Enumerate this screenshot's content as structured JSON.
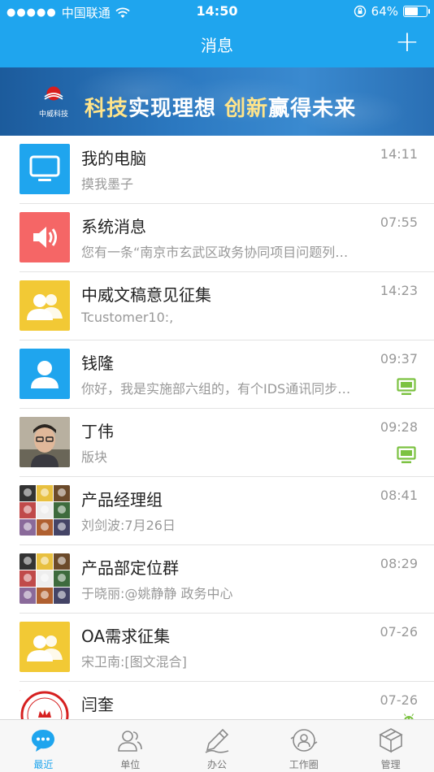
{
  "status_bar": {
    "signal": "●●●●●",
    "carrier": "中国联通",
    "time": "14:50",
    "battery": "64%",
    "battery_level": 0.64
  },
  "nav": {
    "title": "消息",
    "add_label": "+"
  },
  "banner": {
    "logo_text": "中威科技",
    "slogan_hl1": "科技",
    "slogan_1": "实现理想 ",
    "slogan_hl2": "创新",
    "slogan_2": "赢得未来"
  },
  "conversations": [
    {
      "name": "我的电脑",
      "message": "摸我墨子",
      "time": "14:11",
      "avatar": "monitor-icon",
      "avatar_color": "#1fa5ee",
      "device": ""
    },
    {
      "name": "系统消息",
      "message": "您有一条“南京市玄武区政务协同项目问题列…",
      "time": "07:55",
      "avatar": "speaker-icon",
      "avatar_color": "#f56666",
      "device": ""
    },
    {
      "name": "中威文稿意见征集",
      "message": "Tcustomer10:,",
      "time": "14:23",
      "avatar": "group-icon",
      "avatar_color": "#f2c935",
      "device": ""
    },
    {
      "name": "钱隆",
      "message": "你好，我是实施部六组的，有个IDS通讯同步…",
      "time": "09:37",
      "avatar": "user-icon",
      "avatar_color": "#1fa5ee",
      "device": "desktop-online-icon"
    },
    {
      "name": "丁伟",
      "message": "版块",
      "time": "09:28",
      "avatar": "photo",
      "avatar_color": "#8a8070",
      "device": "desktop-online-icon"
    },
    {
      "name": "产品经理组",
      "message": "刘剑波:7月26日",
      "time": "08:41",
      "avatar": "group-photo",
      "avatar_color": "#6a6a6a",
      "device": ""
    },
    {
      "name": "产品部定位群",
      "message": "于晓丽:@姚静静 政务中心",
      "time": "08:29",
      "avatar": "group-photo",
      "avatar_color": "#6a6a6a",
      "device": ""
    },
    {
      "name": "OA需求征集",
      "message": "宋卫南:[图文混合]",
      "time": "07-26",
      "avatar": "group-icon",
      "avatar_color": "#f2c935",
      "device": ""
    },
    {
      "name": "闫奎",
      "message": "",
      "time": "07-26",
      "avatar": "seal",
      "avatar_color": "#d62020",
      "device": "android-icon"
    }
  ],
  "tabs": [
    {
      "label": "最近",
      "icon": "chat-bubble-icon",
      "active": true
    },
    {
      "label": "单位",
      "icon": "contacts-icon",
      "active": false
    },
    {
      "label": "办公",
      "icon": "pen-icon",
      "active": false
    },
    {
      "label": "工作圈",
      "icon": "circle-icon",
      "active": false
    },
    {
      "label": "管理",
      "icon": "box-icon",
      "active": false
    }
  ],
  "colors": {
    "accent": "#1fa5ee",
    "device_green": "#7cc242"
  }
}
